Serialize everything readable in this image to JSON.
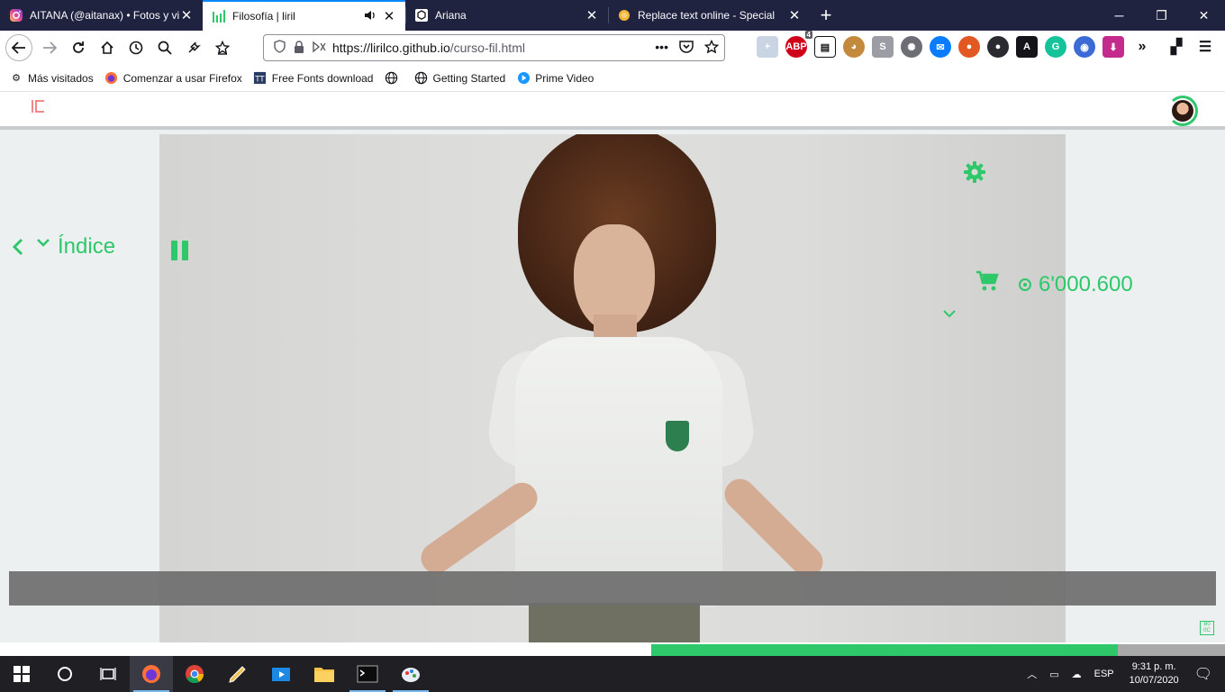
{
  "browser": {
    "tabs": [
      {
        "title": "AITANA (@aitanax) • Fotos y vi",
        "icon": "instagram-icon",
        "active": false
      },
      {
        "title": "Filosofía | liril",
        "icon": "liril-icon",
        "active": true,
        "audio": true
      },
      {
        "title": "Ariana",
        "icon": "codesandbox-icon",
        "active": false
      },
      {
        "title": "Replace text online - Special",
        "icon": "site-icon",
        "active": false
      }
    ],
    "url_host": "https://lirilco.github.io",
    "url_path": "/curso-fil.html",
    "bookmarks": [
      {
        "label": "Más visitados",
        "icon": "gear-icon"
      },
      {
        "label": "Comenzar a usar Firefox",
        "icon": "firefox-icon"
      },
      {
        "label": "Free Fonts download",
        "icon": "fonts-icon"
      },
      {
        "label": "",
        "icon": "globe-icon"
      },
      {
        "label": "Getting Started",
        "icon": "globe-icon"
      },
      {
        "label": "Prime Video",
        "icon": "play-icon"
      }
    ],
    "abp_badge": "4"
  },
  "page": {
    "index_label": "Índice",
    "coins": "6'000.600",
    "accent": "#2ec86a",
    "progress": 0.55
  },
  "taskbar": {
    "time": "9:31 p. m.",
    "date": "10/07/2020",
    "lang": "ESP"
  }
}
